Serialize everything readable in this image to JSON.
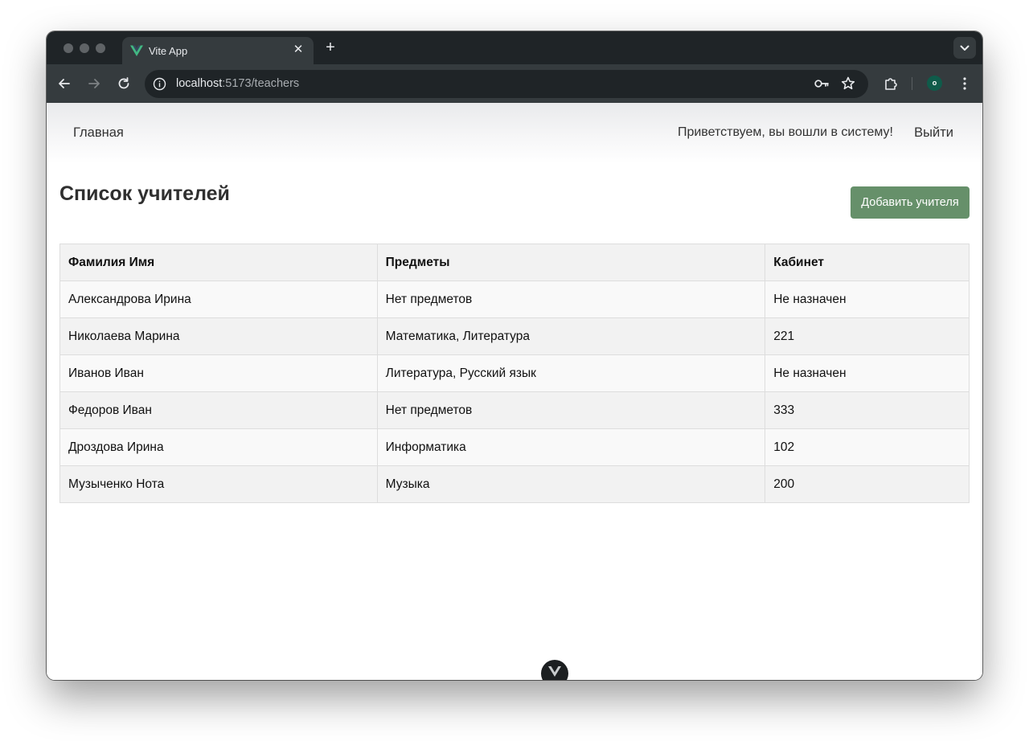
{
  "browser": {
    "tab": {
      "title": "Vite App"
    },
    "address_bar": {
      "host": "localhost",
      "rest": ":5173/teachers"
    },
    "profile_initial": "o",
    "colors": {
      "frame": "#1f2427",
      "toolbar": "#353b3e",
      "vue_green": "#42b883"
    }
  },
  "navbar": {
    "home": "Главная",
    "greeting": "Приветствуем, вы вошли в систему!",
    "logout": "Выйти"
  },
  "main": {
    "title": "Список учителей",
    "add_button": "Добавить учителя",
    "add_button_color": "#66906a",
    "table": {
      "headers": [
        "Фамилия Имя",
        "Предметы",
        "Кабинет"
      ],
      "rows": [
        [
          "Александрова Ирина",
          "Нет предметов",
          "Не назначен"
        ],
        [
          "Николаева Марина",
          "Математика, Литература",
          "221"
        ],
        [
          "Иванов Иван",
          "Литература, Русский язык",
          "Не назначен"
        ],
        [
          "Федоров Иван",
          "Нет предметов",
          "333"
        ],
        [
          "Дроздова Ирина",
          "Информатика",
          "102"
        ],
        [
          "Музыченко Нота",
          "Музыка",
          "200"
        ]
      ]
    }
  }
}
